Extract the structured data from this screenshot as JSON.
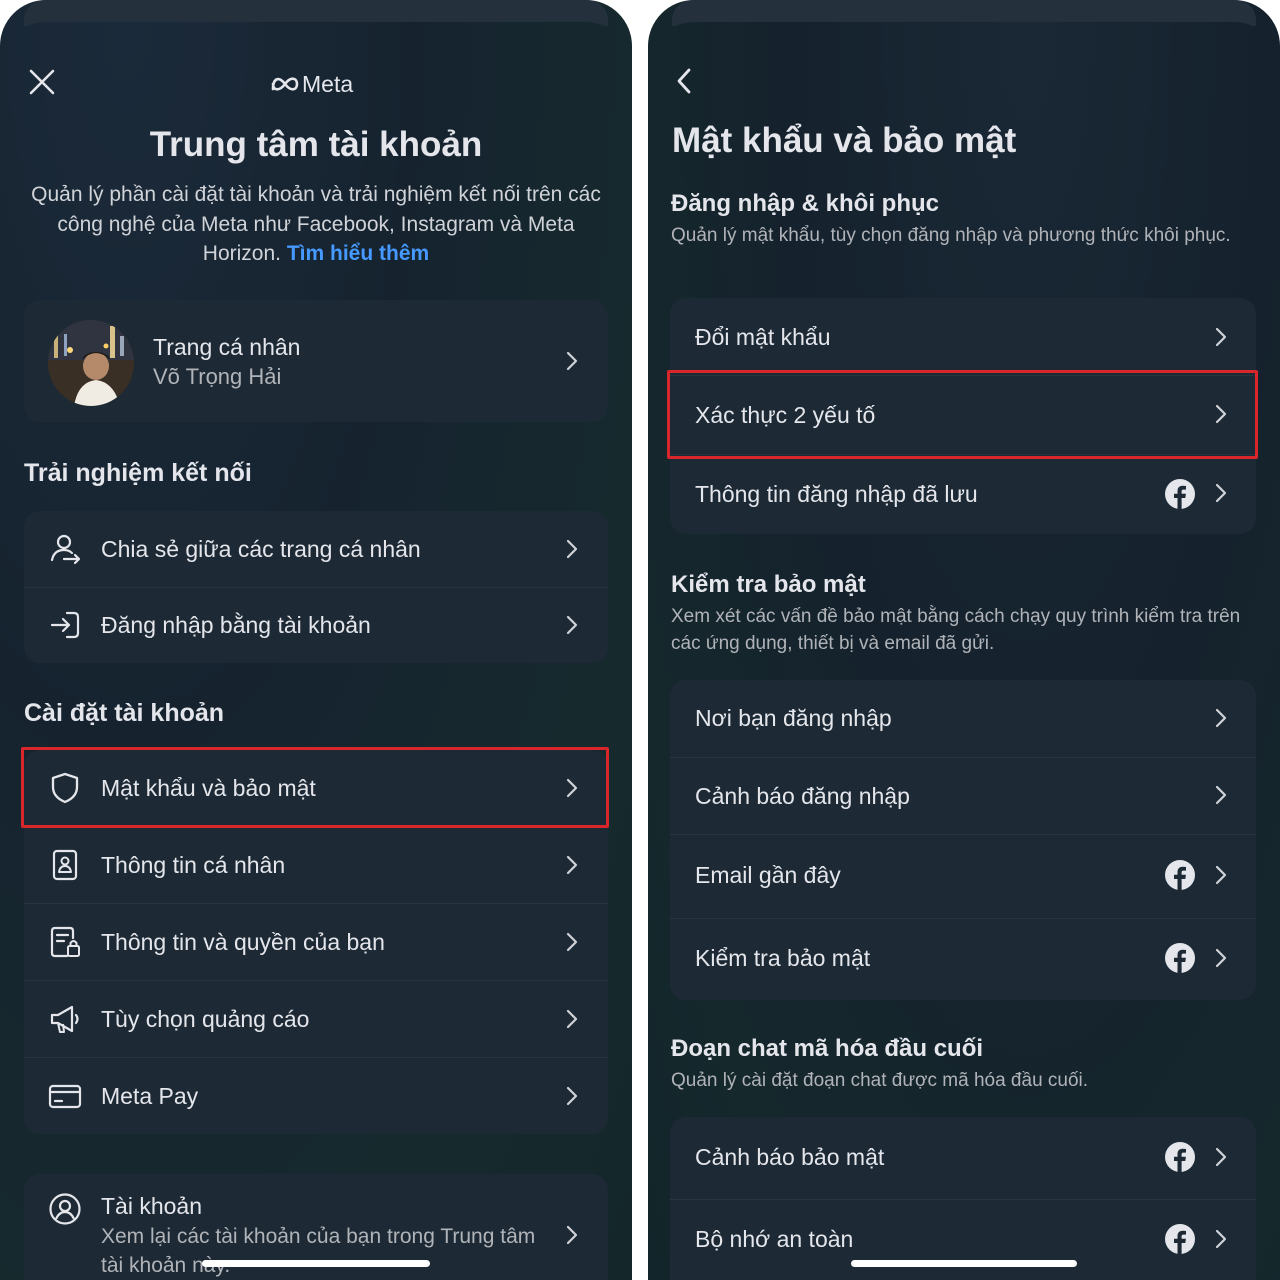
{
  "left": {
    "brand": "Meta",
    "title": "Trung tâm tài khoản",
    "description": "Quản lý phần cài đặt tài khoản và trải nghiệm kết nối trên các công nghệ của Meta như Facebook, Instagram và Meta Horizon.",
    "learn_more": "Tìm hiểu thêm",
    "profile": {
      "label": "Trang cá nhân",
      "name": "Võ Trọng Hải"
    },
    "connected_title": "Trải nghiệm kết nối",
    "connected_items": [
      {
        "label": "Chia sẻ giữa các trang cá nhân",
        "icon": "share-profiles-icon"
      },
      {
        "label": "Đăng nhập bằng tài khoản",
        "icon": "login-arrow-icon"
      }
    ],
    "settings_title": "Cài đặt tài khoản",
    "settings_items": [
      {
        "label": "Mật khẩu và bảo mật",
        "icon": "shield-icon"
      },
      {
        "label": "Thông tin cá nhân",
        "icon": "id-card-icon"
      },
      {
        "label": "Thông tin và quyền của bạn",
        "icon": "document-lock-icon"
      },
      {
        "label": "Tùy chọn quảng cáo",
        "icon": "megaphone-icon"
      },
      {
        "label": "Meta Pay",
        "icon": "credit-card-icon"
      }
    ],
    "accounts": {
      "label": "Tài khoản",
      "sub": "Xem lại các tài khoản của bạn trong Trung tâm tài khoản này."
    }
  },
  "right": {
    "title": "Mật khẩu và bảo mật",
    "login_title": "Đăng nhập & khôi phục",
    "login_sub": "Quản lý mật khẩu, tùy chọn đăng nhập và phương thức khôi phục.",
    "login_items": [
      {
        "label": "Đổi mật khẩu",
        "fb": false
      },
      {
        "label": "Xác thực 2 yếu tố",
        "fb": false
      },
      {
        "label": "Thông tin đăng nhập đã lưu",
        "fb": true
      }
    ],
    "check_title": "Kiểm tra bảo mật",
    "check_sub": "Xem xét các vấn đề bảo mật bằng cách chạy quy trình kiểm tra trên các ứng dụng, thiết bị và email đã gửi.",
    "check_items": [
      {
        "label": "Nơi bạn đăng nhập",
        "fb": false
      },
      {
        "label": "Cảnh báo đăng nhập",
        "fb": false
      },
      {
        "label": "Email gần đây",
        "fb": true
      },
      {
        "label": "Kiểm tra bảo mật",
        "fb": true
      }
    ],
    "e2e_title": "Đoạn chat mã hóa đầu cuối",
    "e2e_sub": "Quản lý cài đặt đoạn chat được mã hóa đầu cuối.",
    "e2e_items": [
      {
        "label": "Cảnh báo bảo mật",
        "fb": true
      },
      {
        "label": "Bộ nhớ an toàn",
        "fb": true
      }
    ]
  },
  "colors": {
    "highlight": "#d9262b",
    "link": "#4599ff",
    "card": "#1d2a35"
  }
}
